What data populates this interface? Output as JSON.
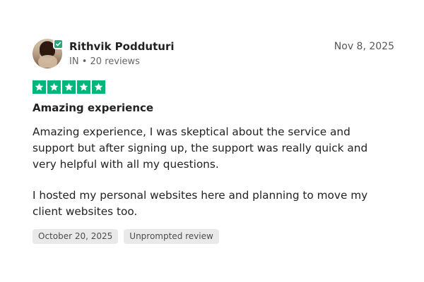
{
  "review": {
    "reviewer": {
      "name": "Rithvik Podduturi",
      "country_code": "IN",
      "reviews_count": "20 reviews",
      "separator": "•",
      "avatar_icon": "profile-photo-icon",
      "verified_icon": "verified-check-icon"
    },
    "date": "Nov 8, 2025",
    "rating": {
      "stars": 5,
      "max": 5,
      "color": "#00b67a"
    },
    "title": "Amazing experience",
    "body": {
      "paragraph_1": "Amazing experience, I was skeptical about the service and support but after signing up, the support was really quick and very helpful with all my questions.",
      "paragraph_2": "I hosted my personal websites here and planning to move my client websites too."
    },
    "tags": {
      "experience_date": "October 20, 2025",
      "review_type": "Unprompted review"
    }
  },
  "colors": {
    "text": "#222222",
    "muted_text": "#666666",
    "tag_background": "#e9e9e9",
    "verified_badge": "#2aa776"
  }
}
